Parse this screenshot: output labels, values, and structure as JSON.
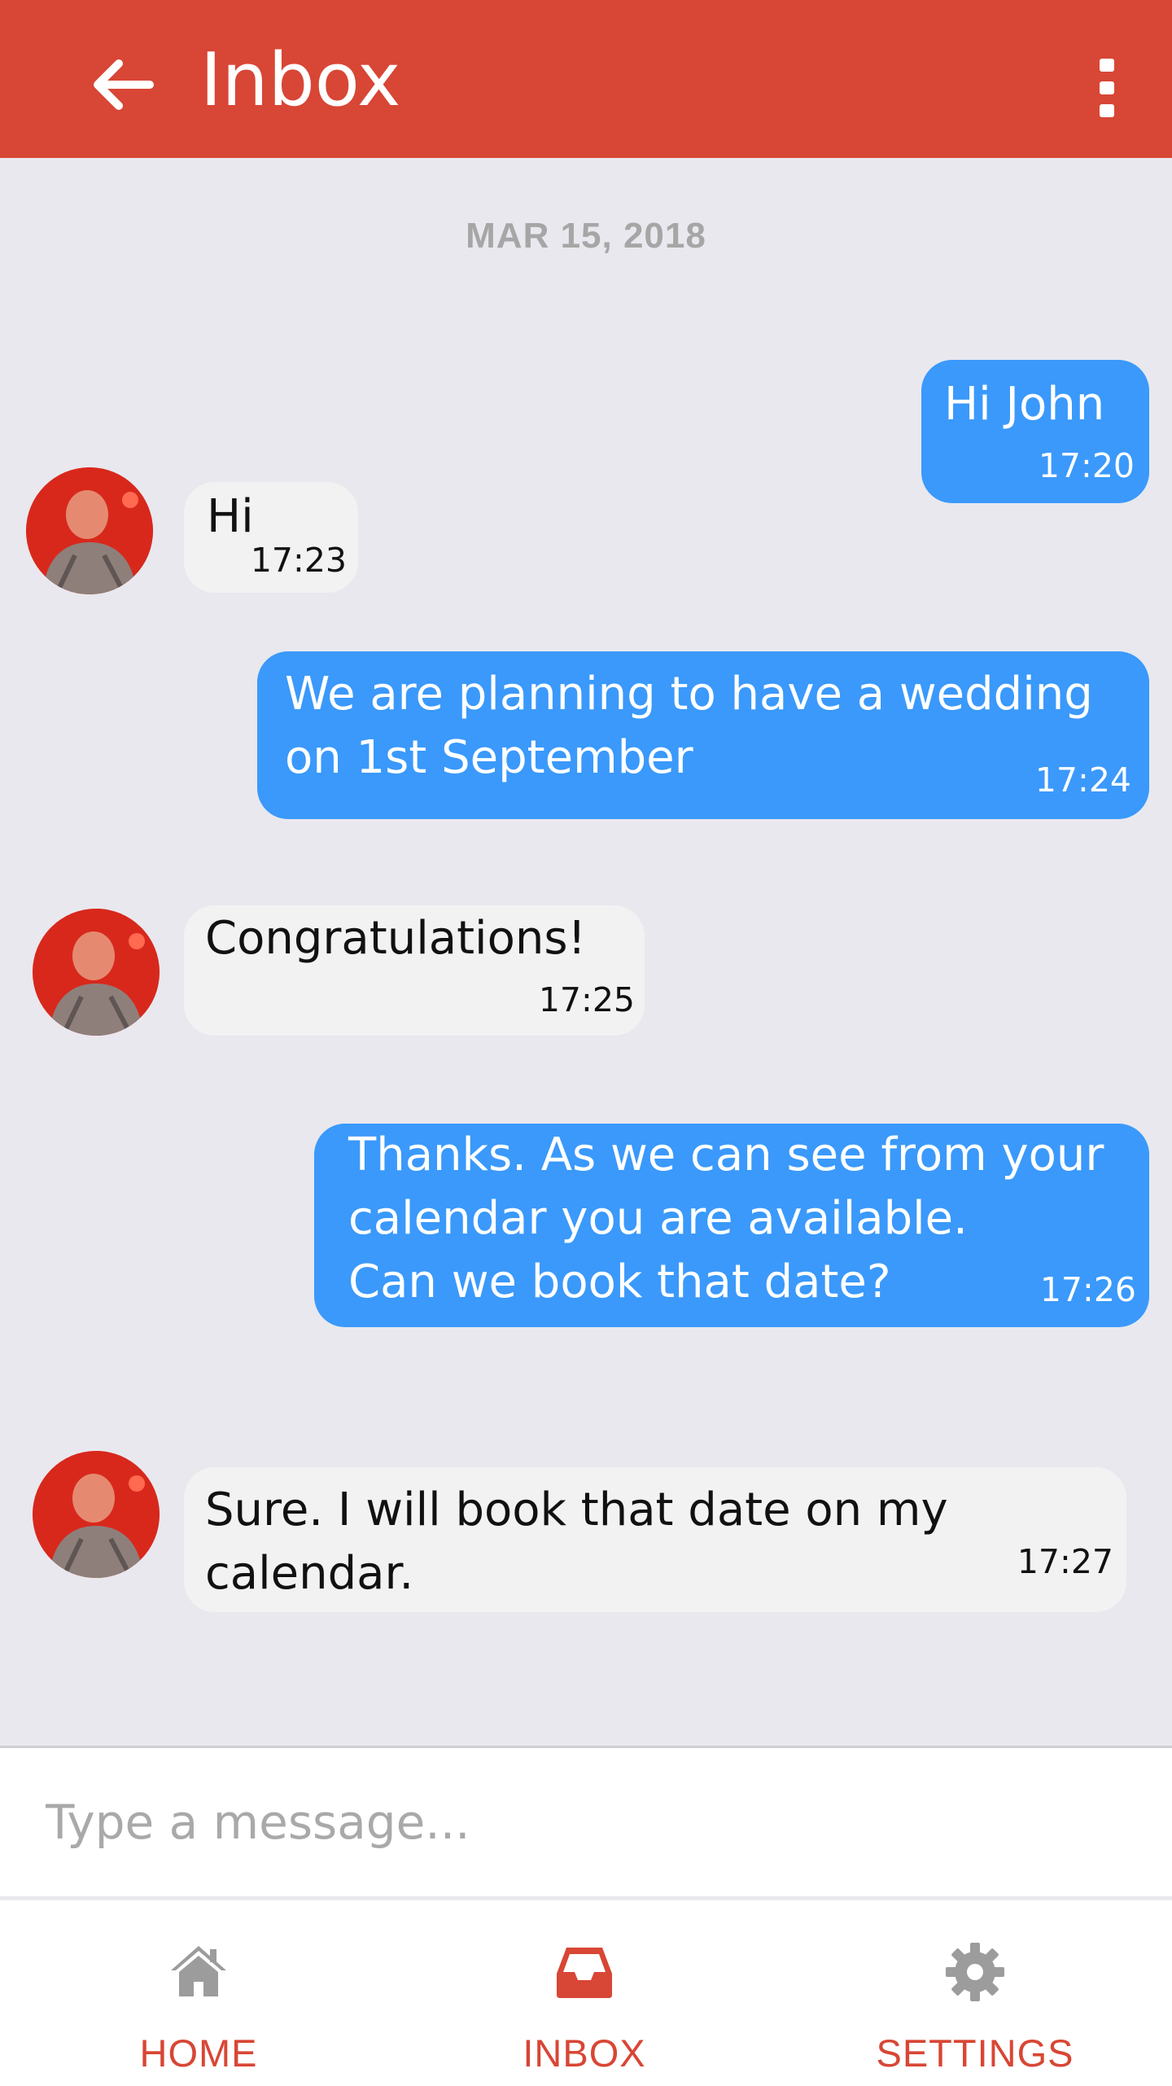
{
  "colors": {
    "header": "#d84635",
    "background": "#e9e8ee",
    "outgoing_bubble": "#3a99fb",
    "incoming_bubble": "#f2f2f2",
    "accent": "#d84635"
  },
  "header": {
    "back_icon": "arrow-left-icon",
    "title": "Inbox",
    "menu_icon": "more-vertical-icon"
  },
  "conversation": {
    "date": "MAR 15, 2018",
    "messages": [
      {
        "direction": "outgoing",
        "text": "Hi John",
        "time": "17:20"
      },
      {
        "direction": "incoming",
        "text": "Hi",
        "time": "17:23"
      },
      {
        "direction": "outgoing",
        "text": "We are planning to have a wedding\non 1st September",
        "time": "17:24"
      },
      {
        "direction": "incoming",
        "text": "Congratulations!",
        "time": "17:25"
      },
      {
        "direction": "outgoing",
        "text": "Thanks. As we can see from your\ncalendar you are available.\nCan we book that date?",
        "time": "17:26"
      },
      {
        "direction": "incoming",
        "text": "Sure. I will book that date on my\ncalendar.",
        "time": "17:27"
      }
    ]
  },
  "composer": {
    "placeholder": "Type a message...",
    "value": ""
  },
  "nav": {
    "items": [
      {
        "label": "HOME",
        "icon": "home-icon",
        "active": false
      },
      {
        "label": "INBOX",
        "icon": "inbox-icon",
        "active": true
      },
      {
        "label": "SETTINGS",
        "icon": "gear-icon",
        "active": false
      }
    ]
  }
}
